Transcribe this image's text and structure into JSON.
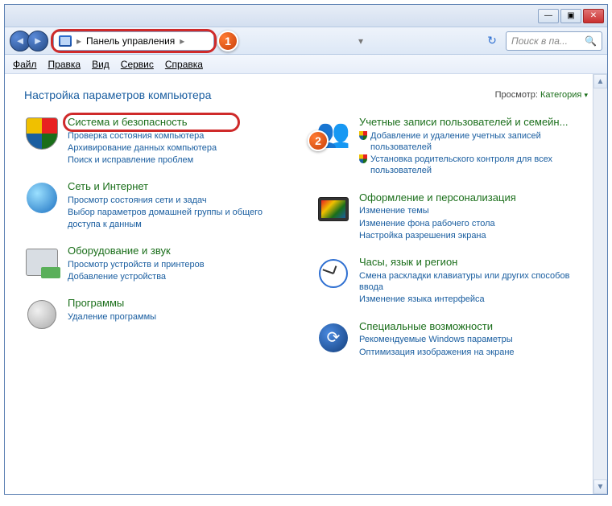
{
  "titlebar": {
    "min": "—",
    "max": "▣",
    "close": "✕"
  },
  "nav": {
    "back": "◄",
    "forward": "►"
  },
  "breadcrumb": {
    "root_sep": "▸",
    "label": "Панель управления",
    "tail_sep": "▸",
    "dropdown": "▾"
  },
  "refresh_glyph": "↻",
  "search": {
    "placeholder": "Поиск в па...",
    "icon": "🔍"
  },
  "menu": {
    "file": "Файл",
    "edit": "Правка",
    "view": "Вид",
    "tools": "Сервис",
    "help": "Справка"
  },
  "heading": "Настройка параметров компьютера",
  "viewby": {
    "label": "Просмотр:",
    "value": "Категория",
    "chev": "▾"
  },
  "markers": {
    "one": "1",
    "two": "2"
  },
  "left": [
    {
      "title": "Система и безопасность",
      "links": [
        "Проверка состояния компьютера",
        "Архивирование данных компьютера",
        "Поиск и исправление проблем"
      ]
    },
    {
      "title": "Сеть и Интернет",
      "links": [
        "Просмотр состояния сети и задач",
        "Выбор параметров домашней группы и общего доступа к данным"
      ]
    },
    {
      "title": "Оборудование и звук",
      "links": [
        "Просмотр устройств и принтеров",
        "Добавление устройства"
      ]
    },
    {
      "title": "Программы",
      "links": [
        "Удаление программы"
      ]
    }
  ],
  "right": [
    {
      "title": "Учетные записи пользователей и семейн...",
      "shield_links": [
        "Добавление и удаление учетных записей пользователей",
        "Установка родительского контроля для всех пользователей"
      ]
    },
    {
      "title": "Оформление и персонализация",
      "links": [
        "Изменение темы",
        "Изменение фона рабочего стола",
        "Настройка разрешения экрана"
      ]
    },
    {
      "title": "Часы, язык и регион",
      "links": [
        "Смена раскладки клавиатуры или других способов ввода",
        "Изменение языка интерфейса"
      ]
    },
    {
      "title": "Специальные возможности",
      "links": [
        "Рекомендуемые Windows параметры",
        "Оптимизация изображения на экране"
      ]
    }
  ],
  "scroll": {
    "up": "▲",
    "down": "▼"
  }
}
